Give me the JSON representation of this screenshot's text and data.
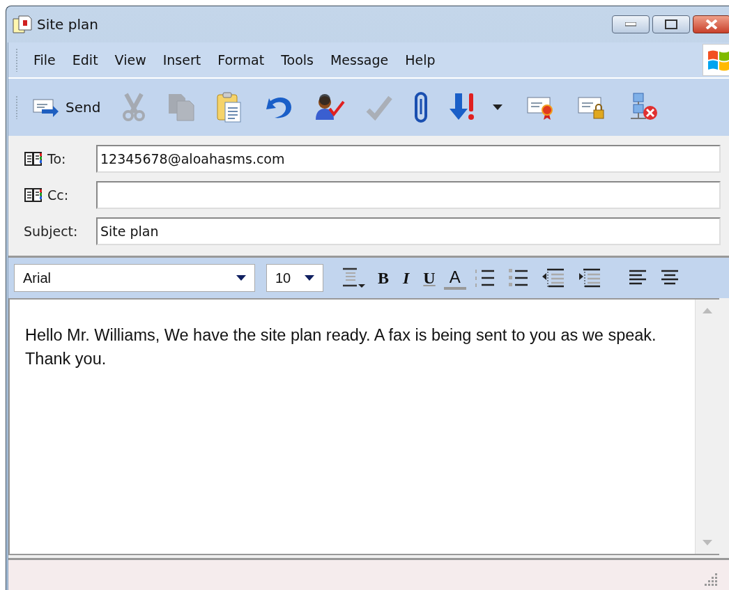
{
  "window": {
    "title": "Site plan"
  },
  "menu": [
    {
      "label": "File"
    },
    {
      "label": "Edit"
    },
    {
      "label": "View"
    },
    {
      "label": "Insert"
    },
    {
      "label": "Format"
    },
    {
      "label": "Tools"
    },
    {
      "label": "Message"
    },
    {
      "label": "Help"
    }
  ],
  "toolbar": [
    {
      "kind": "send",
      "label": "Send",
      "disabled": false
    },
    {
      "kind": "cut",
      "disabled": true
    },
    {
      "kind": "copy",
      "disabled": true
    },
    {
      "kind": "paste",
      "disabled": false
    },
    {
      "kind": "undo",
      "disabled": false
    },
    {
      "kind": "check_names",
      "disabled": false
    },
    {
      "kind": "spelling",
      "disabled": true
    },
    {
      "kind": "attach",
      "disabled": false
    },
    {
      "kind": "priority",
      "disabled": false
    },
    {
      "kind": "caret",
      "disabled": false
    },
    {
      "kind": "sign",
      "disabled": false
    },
    {
      "kind": "encrypt",
      "disabled": false
    },
    {
      "kind": "offline",
      "disabled": false
    }
  ],
  "fields": [
    {
      "kind": "address",
      "label": "To:",
      "value": "12345678@aloahasms.com"
    },
    {
      "kind": "address",
      "label": "Cc:"
    },
    {
      "kind": "plain",
      "label": "Subject:",
      "value": "Site plan"
    }
  ],
  "format_bar": {
    "font": "Arial",
    "size": "10",
    "buttons": [
      {
        "kind": "style"
      },
      {
        "kind": "bold",
        "label": "B"
      },
      {
        "kind": "italic",
        "label": "I"
      },
      {
        "kind": "underline",
        "label": "U"
      },
      {
        "kind": "color",
        "label": "A"
      },
      {
        "kind": "numbered"
      },
      {
        "kind": "bullets"
      },
      {
        "kind": "outdent"
      },
      {
        "kind": "indent"
      },
      {
        "kind": "align_left"
      },
      {
        "kind": "align_center"
      }
    ]
  },
  "body": {
    "text": "Hello Mr. Williams, We have the site plan ready. A fax is being sent to you as we speak. Thank you."
  }
}
